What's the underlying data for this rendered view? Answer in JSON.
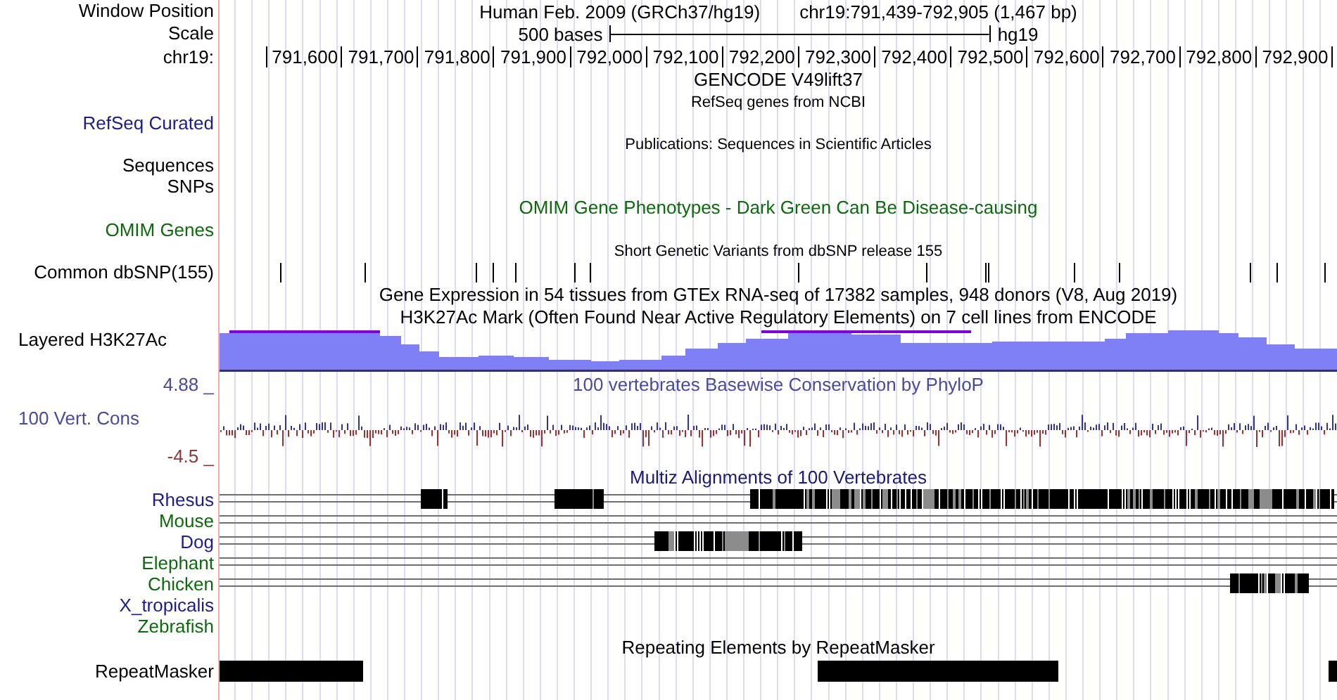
{
  "header": {
    "label": "Window Position",
    "title": "Human Feb. 2009 (GRCh37/hg19)",
    "position": "chr19:791,439-792,905 (1,467 bp)"
  },
  "scale": {
    "label": "Scale",
    "caption": "500 bases",
    "assembly": "hg19"
  },
  "ruler": {
    "label": "chr19:",
    "ticks": [
      "791,600",
      "791,700",
      "791,800",
      "791,900",
      "792,000",
      "792,100",
      "792,200",
      "792,300",
      "792,400",
      "792,500",
      "792,600",
      "792,700",
      "792,800",
      "792,900"
    ]
  },
  "tracks": [
    {
      "kind": "title",
      "text": "GENCODE V49lift37",
      "color": "#000000"
    },
    {
      "kind": "caption",
      "text": "RefSeq genes from NCBI",
      "color": "#000000"
    },
    {
      "kind": "label",
      "label": "RefSeq Curated",
      "color": "#1c1c8c"
    },
    {
      "kind": "caption",
      "text": "Publications: Sequences in Scientific Articles",
      "color": "#000000"
    },
    {
      "kind": "label",
      "label": "Sequences",
      "color": "#000000"
    },
    {
      "kind": "label",
      "label": "SNPs",
      "color": "#000000"
    },
    {
      "kind": "title",
      "text": "OMIM Gene Phenotypes - Dark Green Can Be Disease-causing",
      "color": "#0b6b0b"
    },
    {
      "kind": "label",
      "label": "OMIM Genes",
      "color": "#0b6b0b"
    },
    {
      "kind": "caption",
      "text": "Short Genetic Variants from dbSNP release 155",
      "color": "#000000"
    },
    {
      "kind": "snps",
      "label": "Common dbSNP(155)",
      "color": "#000000"
    },
    {
      "kind": "title",
      "text": "Gene Expression in 54 tissues from GTEx RNA-seq of 17382 samples, 948 donors (V8, Aug 2019)",
      "color": "#000000"
    },
    {
      "kind": "title",
      "text": "H3K27Ac Mark (Often Found Near Active Regulatory Elements) on 7 cell lines from ENCODE",
      "color": "#000000"
    },
    {
      "kind": "signal",
      "label": "Layered H3K27Ac",
      "color": "#000000"
    },
    {
      "kind": "conservation",
      "upper": "4.88 _",
      "title": "100 vertebrates Basewise Conservation by PhyloP",
      "label": "100 Vert. Cons",
      "lower": "-4.5 _",
      "color": "#4a4a9c"
    },
    {
      "kind": "title",
      "text": "Multiz Alignments of 100 Vertebrates",
      "color": "#1a1a75"
    },
    {
      "kind": "species",
      "label": "Rhesus",
      "color": "#1c1c8c",
      "aligned": true
    },
    {
      "kind": "species",
      "label": "Mouse",
      "color": "#0b6b0b",
      "aligned": true
    },
    {
      "kind": "species",
      "label": "Dog",
      "color": "#1c1c8c",
      "aligned": true
    },
    {
      "kind": "species",
      "label": "Elephant",
      "color": "#0b6b0b",
      "aligned": true
    },
    {
      "kind": "species",
      "label": "Chicken",
      "color": "#0b6b0b",
      "aligned": true
    },
    {
      "kind": "species",
      "label": "X_tropicalis",
      "color": "#1c1c8c",
      "aligned": false
    },
    {
      "kind": "species",
      "label": "Zebrafish",
      "color": "#0b6b0b",
      "aligned": false
    },
    {
      "kind": "title",
      "text": "Repeating Elements by RepeatMasker",
      "color": "#000000"
    },
    {
      "kind": "repeats",
      "label": "RepeatMasker",
      "color": "#000000"
    }
  ]
}
